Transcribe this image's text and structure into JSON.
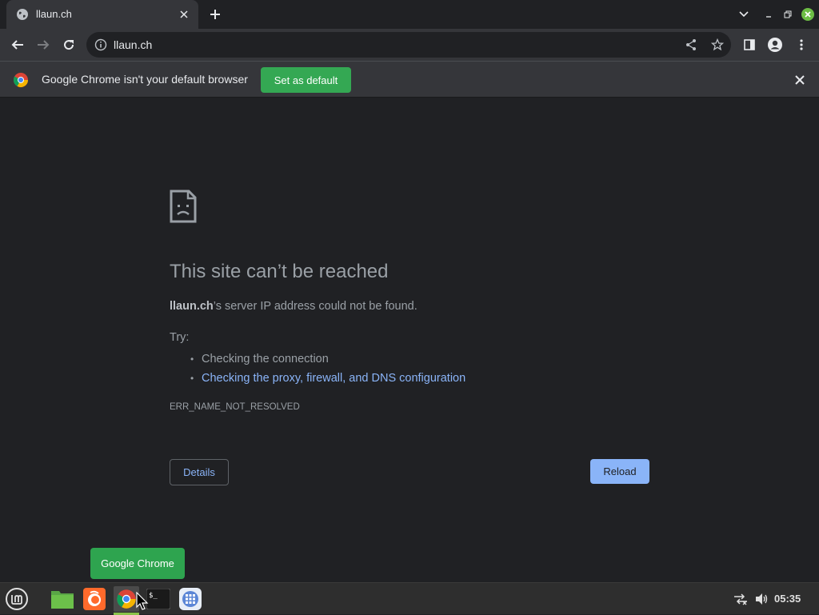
{
  "tab": {
    "title": "llaun.ch"
  },
  "toolbar": {
    "url": "llaun.ch"
  },
  "infobar": {
    "message": "Google Chrome isn't your default browser",
    "set_default_label": "Set as default"
  },
  "error_page": {
    "heading": "This site can’t be reached",
    "domain": "llaun.ch",
    "description_rest": "’s server IP address could not be found.",
    "try_label": "Try:",
    "suggestions": [
      {
        "text": "Checking the connection",
        "is_link": false
      },
      {
        "text": "Checking the proxy, firewall, and DNS configuration",
        "is_link": true
      }
    ],
    "error_code": "ERR_NAME_NOT_RESOLVED",
    "details_label": "Details",
    "reload_label": "Reload"
  },
  "tooltip": {
    "text": "Google Chrome"
  },
  "taskbar": {
    "apps": [
      {
        "name": "files-icon"
      },
      {
        "name": "firefox-icon"
      },
      {
        "name": "chrome-icon",
        "active": true
      },
      {
        "name": "terminal-icon"
      },
      {
        "name": "app-grid-icon"
      }
    ],
    "clock": "05:35"
  },
  "colors": {
    "accent_green": "#34a853",
    "link_blue": "#8ab4f8",
    "page_bg": "#202124",
    "toolbar_bg": "#35363a"
  }
}
